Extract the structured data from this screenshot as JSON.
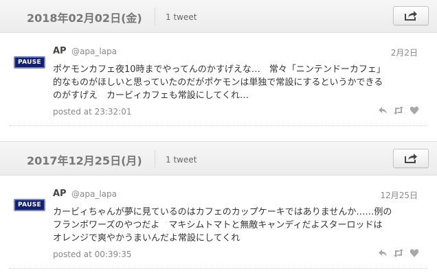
{
  "days": [
    {
      "date": "2018年02月02日(金)",
      "count": "1 tweet",
      "tweets": [
        {
          "avatar_text": "PAUSE",
          "name": "AP",
          "handle": "@apa_lapa",
          "date": "2月2日",
          "lines": [
            "ポケモンカフェ夜10時までやってんのかすげえな…　常々「ニンテンドーカフェ」",
            "的なものがほしいと思っていたのだがポケモンは単独で常設にするというかできる",
            "のがすげえ　カービィカフェも常設にしてくれ…"
          ],
          "posted": "posted at 23:32:01"
        }
      ]
    },
    {
      "date": "2017年12月25日(月)",
      "count": "1 tweet",
      "tweets": [
        {
          "avatar_text": "PAUSE",
          "name": "AP",
          "handle": "@apa_lapa",
          "date": "12月25日",
          "lines": [
            "カービィちゃんが夢に見ているのはカフェのカップケーキではありませんか……例の",
            "フランボワーズのやつだよ　マキシムトマトと無敵キャンディだよスターロッドは",
            "オレンジで爽やかうまいんだよ常設にしてくれ"
          ],
          "posted": "posted at 00:39:35"
        }
      ]
    }
  ],
  "icons": {
    "share": "share-icon",
    "reply": "reply-icon",
    "retweet": "retweet-icon",
    "like": "heart-icon"
  },
  "colors": {
    "avatar_bg": "#13206e",
    "icon_gray": "#a8a8a8"
  }
}
